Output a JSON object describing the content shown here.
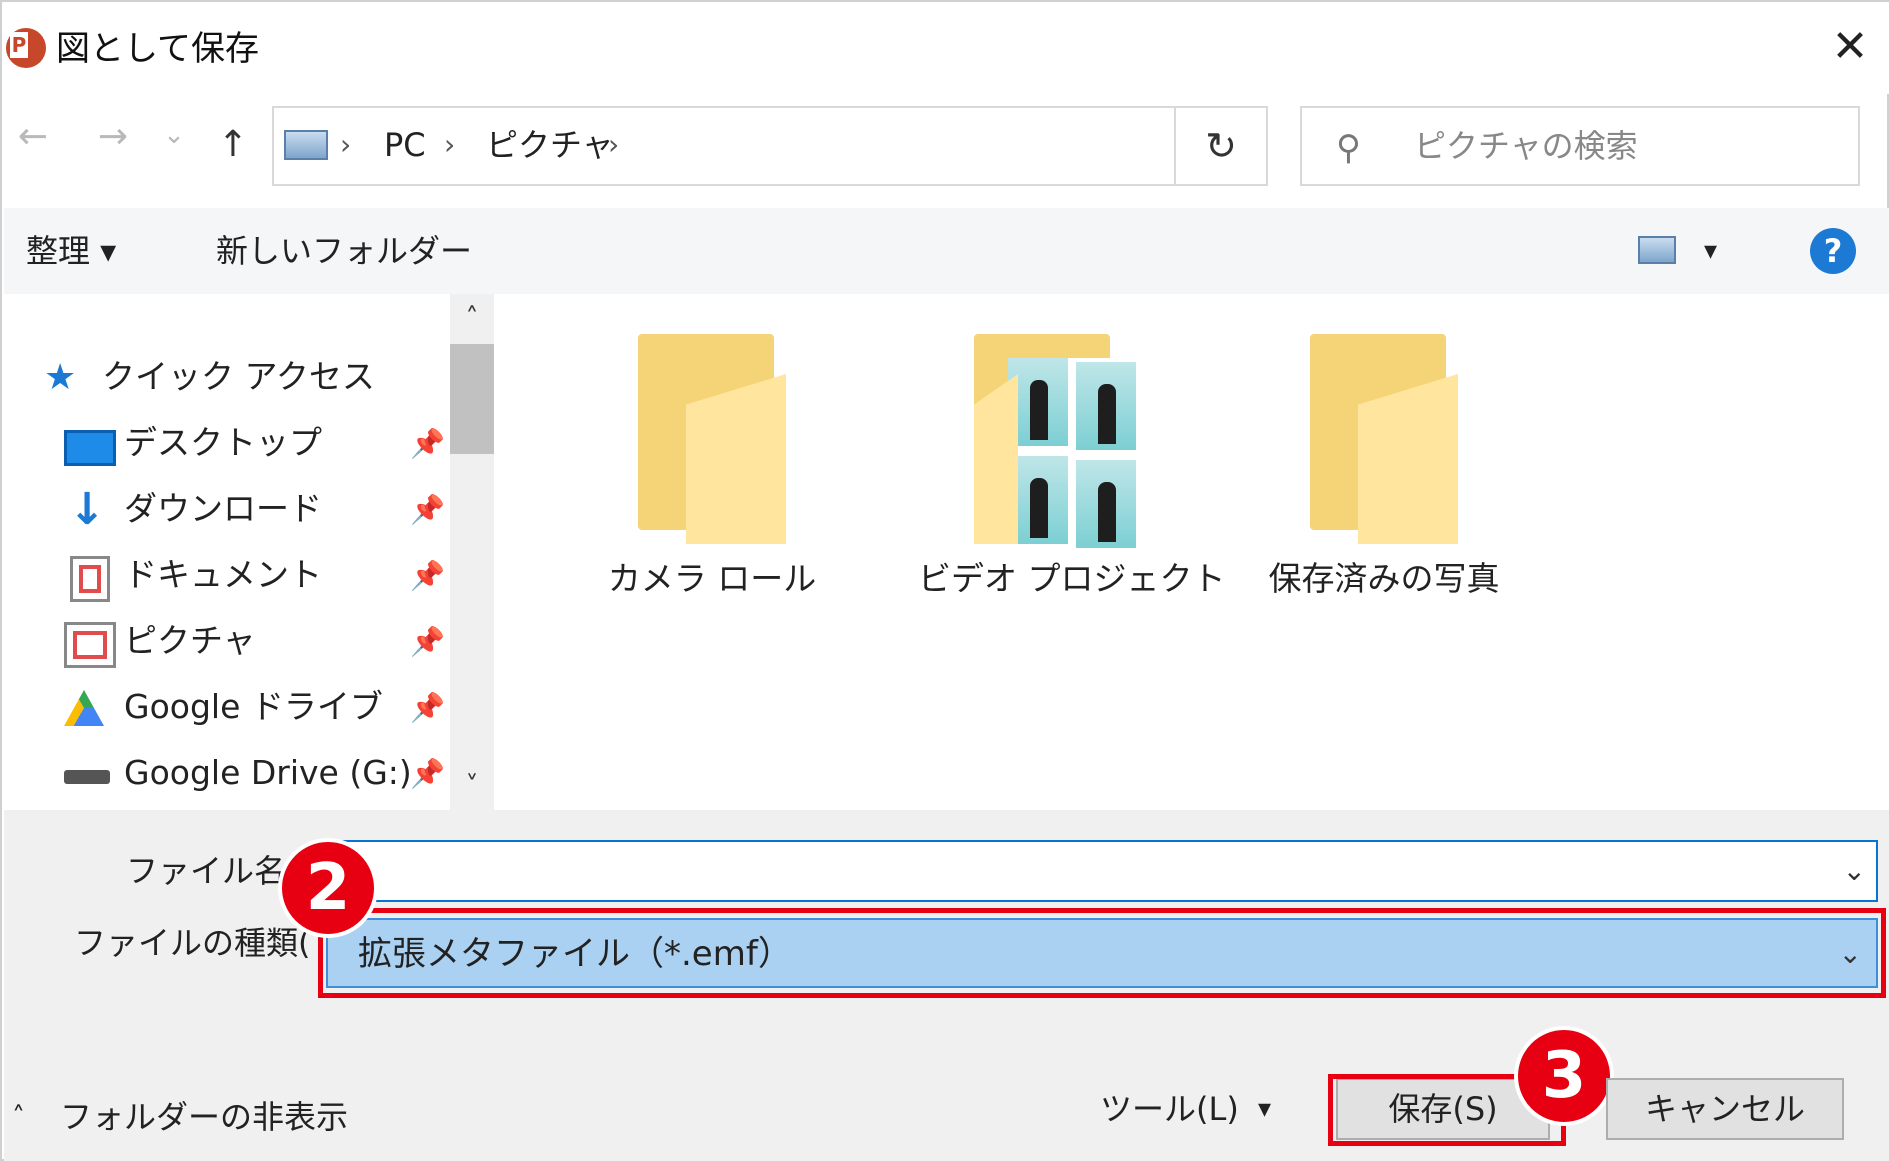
{
  "title_bar": {
    "title": "図として保存",
    "close": "✕"
  },
  "nav": {
    "back": "←",
    "forward": "→",
    "recent": "⌄",
    "up": "↑",
    "breadcrumb": [
      "PC",
      "ピクチャ"
    ],
    "sep": "›",
    "address_dropdown": "⌄",
    "refresh": "↻",
    "search_placeholder": "ピクチャの検索"
  },
  "toolbar": {
    "organize": "整理 ▾",
    "new_folder": "新しいフォルダー",
    "view_dropdown": "▾",
    "help": "?"
  },
  "sidebar": {
    "items": [
      {
        "label": "クイック アクセス",
        "icon": "star-icon"
      },
      {
        "label": "デスクトップ",
        "icon": "desktop-icon",
        "pinned": true
      },
      {
        "label": "ダウンロード",
        "icon": "download-icon",
        "pinned": true
      },
      {
        "label": "ドキュメント",
        "icon": "documents-icon",
        "pinned": true
      },
      {
        "label": "ピクチャ",
        "icon": "pictures-icon",
        "pinned": true
      },
      {
        "label": "Google ドライブ",
        "icon": "google-drive-icon",
        "pinned": true
      },
      {
        "label": "Google Drive (G:)",
        "icon": "drive-icon",
        "pinned": true
      }
    ],
    "pin_glyph": "📌",
    "scroll_up": "˄",
    "scroll_down": "˅"
  },
  "folders": [
    {
      "label": "カメラ ロール",
      "type": "folder"
    },
    {
      "label": "ビデオ プロジェクト",
      "type": "folder-photos"
    },
    {
      "label": "保存済みの写真",
      "type": "folder"
    }
  ],
  "form": {
    "filename_label": "ファイル名(N",
    "filename_value": "",
    "filetype_label": "ファイルの種類(T):",
    "filetype_value": "拡張メタファイル（*.emf）",
    "dropdown_glyph": "⌄"
  },
  "footer": {
    "hide_folders": "フォルダーの非表示",
    "hide_chevron": "˄",
    "tools": "ツール(L)",
    "tools_dd": "▾",
    "save": "保存(S)",
    "cancel": "キャンセル"
  },
  "annotations": {
    "step2": "2",
    "step3": "3"
  },
  "colors": {
    "highlight_red": "#e60012",
    "selected_blue": "#aad1f2",
    "focus_blue": "#0a72d0",
    "help_blue": "#1c7ad4"
  }
}
